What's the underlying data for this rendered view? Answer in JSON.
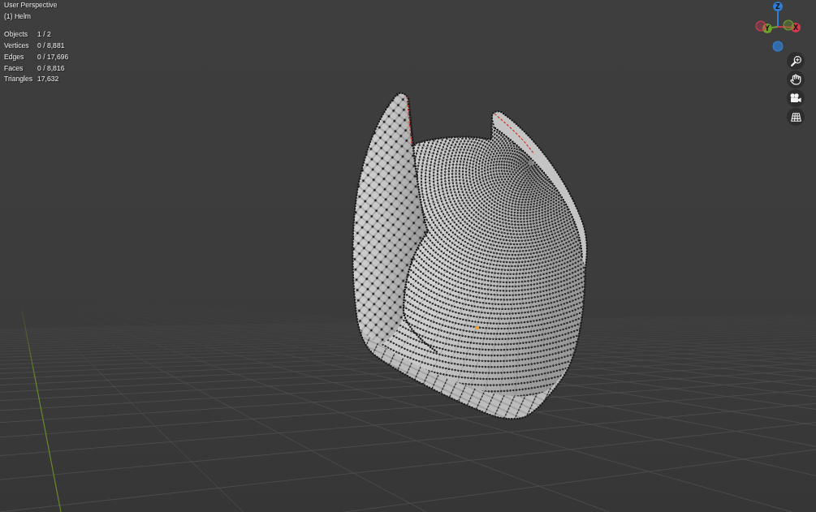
{
  "viewport": {
    "view_name": "User Perspective",
    "object_name": "(1) Helm"
  },
  "stats": [
    {
      "label": "Objects",
      "value": "1 / 2"
    },
    {
      "label": "Vertices",
      "value": "0 / 8,881"
    },
    {
      "label": "Edges",
      "value": "0 / 17,696"
    },
    {
      "label": "Faces",
      "value": "0 / 8,816"
    },
    {
      "label": "Triangles",
      "value": "17,632"
    }
  ],
  "gizmo": {
    "axes": [
      {
        "label": "Z",
        "color": "#2f7fd6"
      },
      {
        "label": "Y",
        "color": "#6ea12a"
      },
      {
        "label": "X",
        "color": "#d13a50"
      }
    ]
  }
}
